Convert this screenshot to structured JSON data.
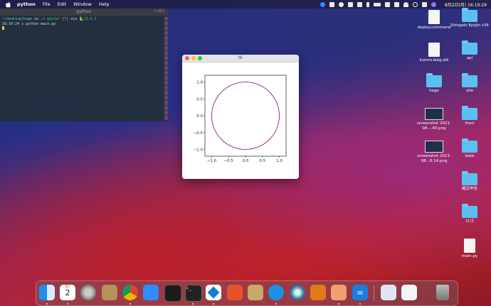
{
  "menubar": {
    "app_name": "python",
    "menus": [
      "File",
      "Edit",
      "Window",
      "Help"
    ],
    "clock": "8月2日(月) 16:19:29",
    "status_icons": [
      "zoom-icon",
      "dropbox-icon",
      "p-icon",
      "battery-status-icon",
      "mirror-icon",
      "bluetooth-icon",
      "battery-icon",
      "input-source-icon",
      "volume-icon",
      "wifi-icon",
      "search-icon",
      "control-center-icon",
      "siri-icon"
    ]
  },
  "terminal": {
    "title": "python",
    "shortcut": "⌥⌘1",
    "line1_path": "~/desktop/hoge",
    "line1_on": "on",
    "line1_branch": "master",
    "line1_status": "[!]",
    "line1_via": "via",
    "line1_version": "v3.9.1",
    "line2_time": "16:10:24",
    "line2_cmd": "❯ python main.py"
  },
  "tk_window": {
    "title": "tk"
  },
  "chart_data": {
    "type": "line",
    "title": "",
    "xlabel": "",
    "ylabel": "",
    "xlim": [
      -1.2,
      1.2
    ],
    "ylim": [
      -1.2,
      1.2
    ],
    "xticks": [
      "−1.0",
      "−0.5",
      "0.0",
      "0.5",
      "1.0"
    ],
    "yticks": [
      "1.0",
      "0.5",
      "0.0",
      "−0.5",
      "−1.0"
    ],
    "xtick_values": [
      -1.0,
      -0.5,
      0.0,
      0.5,
      1.0
    ],
    "ytick_values": [
      1.0,
      0.5,
      0.0,
      -0.5,
      -1.0
    ],
    "series": [
      {
        "shape": "circle",
        "center": [
          0,
          0
        ],
        "radius": 1.0,
        "color": "#800080"
      }
    ]
  },
  "desktop_icons": [
    {
      "label": "deploy.command",
      "kind": "doc"
    },
    {
      "label": "Shingeki Kyojin v34",
      "kind": "folder"
    },
    {
      "label": "kuroro.blog.stk",
      "kind": "doc"
    },
    {
      "label": "api",
      "kind": "folder"
    },
    {
      "label": "hoge",
      "kind": "folder"
    },
    {
      "label": "site",
      "kind": "folder"
    },
    {
      "label": "screenshot 2021-08....40.png",
      "kind": "shot"
    },
    {
      "label": "front",
      "kind": "folder"
    },
    {
      "label": "screenshot 2021-08...6.14.png",
      "kind": "shot"
    },
    {
      "label": "tools",
      "kind": "folder"
    },
    {
      "label": "確定申告",
      "kind": "folder"
    },
    {
      "label": "ロゴ",
      "kind": "folder"
    },
    {
      "label": "main.py",
      "kind": "doc"
    }
  ],
  "dock": {
    "calendar_month": "8月",
    "calendar_day": "2",
    "items": [
      "finder-icon",
      "calendar-icon",
      "system-preferences-icon",
      "contacts-icon",
      "chrome-icon",
      "zoom-icon",
      "activity-monitor-icon",
      "terminal-icon",
      "vscode-icon",
      "instruments-icon",
      "archive-utility-icon",
      "docker-icon",
      "quicktime-icon",
      "sourcetree-icon",
      "preview-icon",
      "infinity-icon",
      "screenshot-stack-icon",
      "documents-stack-icon",
      "trash-icon"
    ]
  }
}
